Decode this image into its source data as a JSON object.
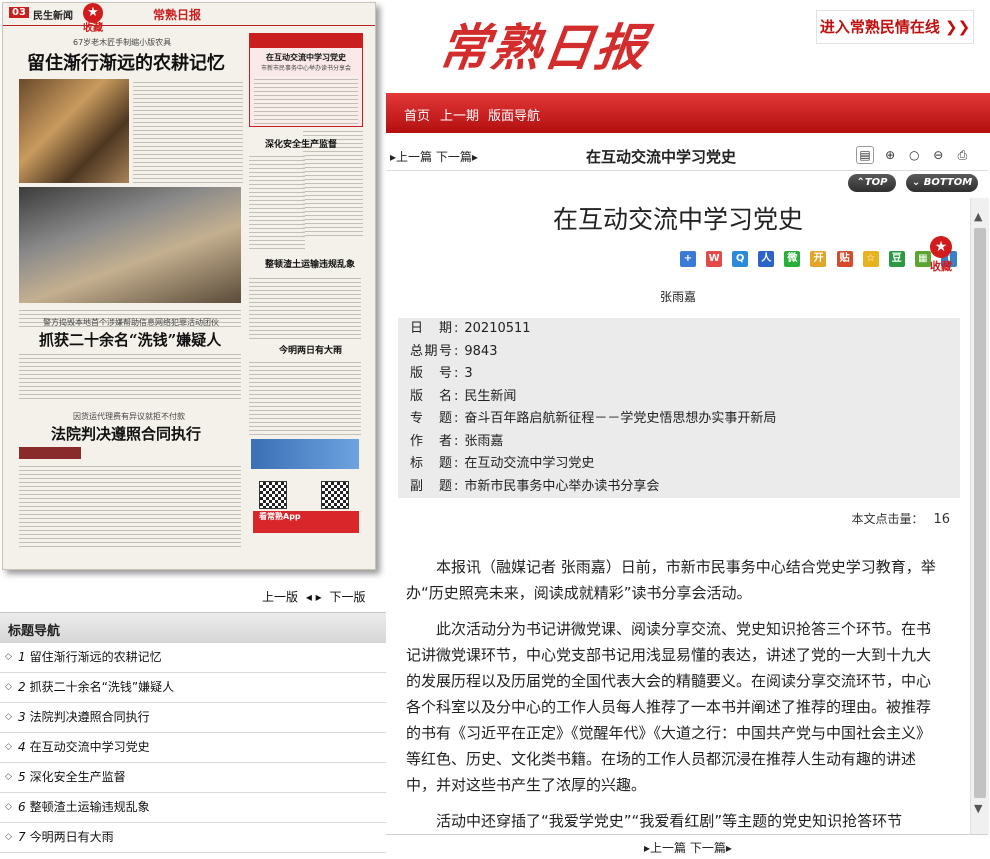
{
  "paper_preview": {
    "page_no": "03",
    "section": "民生新闻",
    "favorite_label": "收藏",
    "paper_name": "常熟日报",
    "kicker1": "67岁老木匠手制缩小版农具",
    "headline1": "留住渐行渐远的农耕记忆",
    "kicker2": "警方捣毁本地首个涉嫌帮助信息网络犯罪活动团伙",
    "headline2": "抓获二十余名“洗钱”嫌疑人",
    "kicker3": "因货运代理费有异议就拒不付款",
    "headline3": "法院判决遵照合同执行",
    "box_title": "在互动交流中学习党史",
    "box_sub": "市新市民事务中心举办读书分享会",
    "headline4": "深化安全生产监督",
    "headline5": "整顿渣土运输违规乱象",
    "headline6": "今明两日有大雨",
    "app_banner": "看常熟App"
  },
  "left_pager": {
    "prev": "上一版",
    "next": "下一版"
  },
  "title_nav": {
    "header": "标题导航",
    "items": [
      {
        "num": "1",
        "title": "留住渐行渐远的农耕记忆"
      },
      {
        "num": "2",
        "title": "抓获二十余名“洗钱”嫌疑人"
      },
      {
        "num": "3",
        "title": "法院判决遵照合同执行"
      },
      {
        "num": "4",
        "title": "在互动交流中学习党史"
      },
      {
        "num": "5",
        "title": "深化安全生产监督"
      },
      {
        "num": "6",
        "title": "整顿渣土运输违规乱象"
      },
      {
        "num": "7",
        "title": "今明两日有大雨"
      }
    ]
  },
  "header": {
    "logo": "常熟日报",
    "minqing_link": "进入常熟民情在线 ❯❯",
    "nav": [
      "首页",
      "上一期",
      "版面导航"
    ]
  },
  "toolbar": {
    "prev_next": "▸上一篇 下一篇▸",
    "title": "在互动交流中学习党史",
    "top_label": "⌃TOP",
    "bottom_label": "⌄ BOTTOM"
  },
  "article": {
    "title": "在互动交流中学习党史",
    "favorite_label": "收藏",
    "author": "张雨嘉",
    "meta": [
      {
        "key": "日期",
        "value": "20210511"
      },
      {
        "key": "总期号",
        "value": "9843"
      },
      {
        "key": "版号",
        "value": "3"
      },
      {
        "key": "版名",
        "value": "民生新闻"
      },
      {
        "key": "专题",
        "value": "奋斗百年路启航新征程－－学党史悟思想办实事开新局"
      },
      {
        "key": "作者",
        "value": "张雨嘉"
      },
      {
        "key": "标题",
        "value": "在互动交流中学习党史"
      },
      {
        "key": "副题",
        "value": "市新市民事务中心举办读书分享会"
      }
    ],
    "hits_label": "本文点击量：",
    "hits_value": "16",
    "paragraphs": [
      "本报讯（融媒记者 张雨嘉）日前，市新市民事务中心结合党史学习教育，举办“历史照亮未来，阅读成就精彩”读书分享会活动。",
      "此次活动分为书记讲微党课、阅读分享交流、党史知识抢答三个环节。在书记讲微党课环节，中心党支部书记用浅显易懂的表达，讲述了党的一大到十九大的发展历程以及历届党的全国代表大会的精髓要义。在阅读分享交流环节，中心各个科室以及分中心的工作人员每人推荐了一本书并阐述了推荐的理由。被推荐的书有《习近平在正定》《觉醒年代》《大道之行：中国共产党与中国社会主义》等红色、历史、文化类书籍。在场的工作人员都沉浸在推荐人生动有趣的讲述中，并对这些书产生了浓厚的兴趣。",
      "活动中还穿插了“我爱学党史”“我爱看红剧”等主题的党史知识抢答环节"
    ]
  },
  "bottom_nav": {
    "label": "▸上一篇 下一篇▸"
  },
  "colors": {
    "brand_red": "#d32c2c",
    "nav_red": "#c41515",
    "meta_bg": "#ebebeb"
  }
}
